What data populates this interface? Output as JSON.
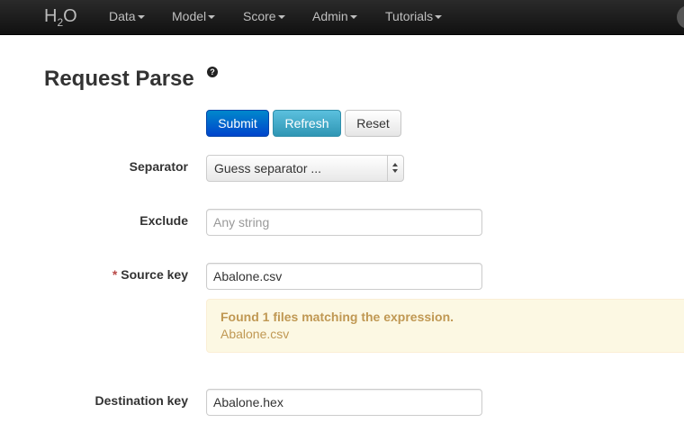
{
  "navbar": {
    "brand_main": "H",
    "brand_sub": "2",
    "brand_tail": "O",
    "items": [
      {
        "label": "Data"
      },
      {
        "label": "Model"
      },
      {
        "label": "Score"
      },
      {
        "label": "Admin"
      },
      {
        "label": "Tutorials"
      }
    ]
  },
  "page": {
    "title": "Request Parse",
    "help_glyph": "?"
  },
  "actions": {
    "submit": "Submit",
    "refresh": "Refresh",
    "reset": "Reset"
  },
  "form": {
    "separator": {
      "label": "Separator",
      "selected": "Guess separator ..."
    },
    "exclude": {
      "label": "Exclude",
      "value": "",
      "placeholder": "Any string"
    },
    "source_key": {
      "required_mark": "*",
      "label": "Source key",
      "value": "Abalone.csv"
    },
    "destination_key": {
      "label": "Destination key",
      "value": "Abalone.hex"
    }
  },
  "match_alert": {
    "title": "Found 1 files matching the expression.",
    "files": [
      "Abalone.csv"
    ]
  },
  "colors": {
    "primary": "#0044cc",
    "info": "#2f96b4",
    "warning_bg": "#fcf8e3",
    "warning_text": "#c09853"
  }
}
